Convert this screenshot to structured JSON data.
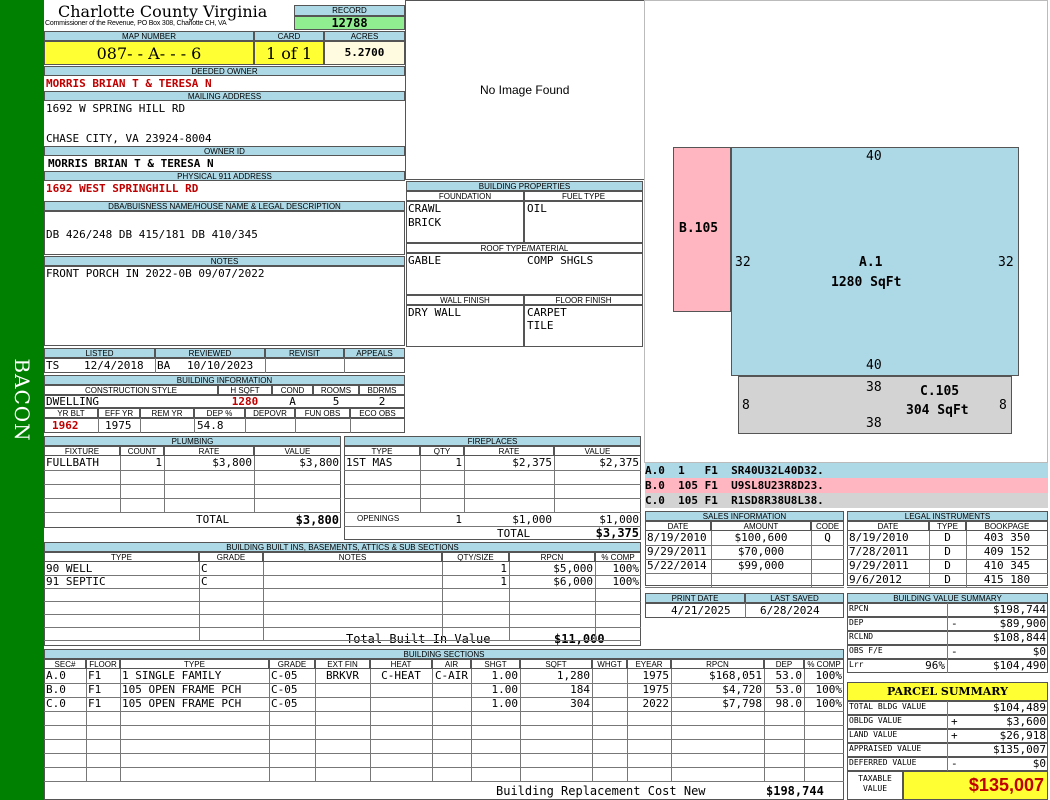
{
  "sidebar": {
    "label": "BACON",
    "color": "#008000"
  },
  "header": {
    "county": "Charlotte County Virginia",
    "commissioner": "Commissioner of the Revenue, PO Box 308, Charlotte CH, VA",
    "record_label": "RECORD",
    "record": "12788",
    "map_label": "MAP NUMBER",
    "map": "087- - A- - - 6",
    "card_label": "CARD",
    "card": "1 of 1",
    "acres_label": "ACRES",
    "acres": "5.2700"
  },
  "owner": {
    "deeded_label": "DEEDED OWNER",
    "deeded": "MORRIS BRIAN T & TERESA N",
    "mailing_label": "MAILING ADDRESS",
    "mail1": "1692 W SPRING HILL RD",
    "mail2": "CHASE CITY, VA 23924-8004",
    "ownerid_label": "OWNER ID",
    "ownerid": "MORRIS BRIAN T & TERESA N",
    "phys_label": "PHYSICAL 911 ADDRESS",
    "phys": "1692 WEST SPRINGHILL RD",
    "dba_label": "DBA/BUISNESS NAME/HOUSE NAME & LEGAL DESCRIPTION",
    "dba": "DB 426/248 DB 415/181 DB 410/345",
    "notes_label": "NOTES",
    "notes": "FRONT PORCH IN 2022-0B 09/07/2022"
  },
  "image": {
    "text": "No Image Found"
  },
  "bldgprops": {
    "title": "BUILDING PROPERTIES",
    "foundation_label": "FOUNDATION",
    "foundation1": "CRAWL",
    "foundation2": "BRICK",
    "fuel_label": "FUEL TYPE",
    "fuel": "OIL",
    "roof_label": "ROOF TYPE/MATERIAL",
    "roof1": "GABLE",
    "roof2": "COMP SHGLS",
    "wall_label": "WALL FINISH",
    "wall": "DRY WALL",
    "floor_label": "FLOOR FINISH",
    "floor1": "CARPET",
    "floor2": "TILE"
  },
  "review": {
    "listed_label": "LISTED",
    "reviewed_label": "REVIEWED",
    "revisit_label": "REVISIT",
    "appeals_label": "APPEALS",
    "listed_by": "TS",
    "listed": "12/4/2018",
    "reviewed_by": "BA",
    "reviewed": "10/10/2023"
  },
  "bldginfo": {
    "title": "BUILDING INFORMATION",
    "style_label": "CONSTRUCTION STYLE",
    "hsqft_label": "H SQFT",
    "cond_label": "COND",
    "rooms_label": "ROOMS",
    "bdrms_label": "BDRMS",
    "style": "DWELLING",
    "hsqft": "1280",
    "cond": "A",
    "rooms": "5",
    "bdrms": "2",
    "yrblt_label": "YR BLT",
    "effyr_label": "EFF YR",
    "remyr_label": "REM YR",
    "dep_label": "DEP %",
    "depovr_label": "DEPOVR",
    "funobs_label": "FUN OBS",
    "ecoobs_label": "ECO OBS",
    "yrblt": "1962",
    "effyr": "1975",
    "dep": "54.8"
  },
  "plumbing": {
    "title": "PLUMBING",
    "headers": [
      "FIXTURE",
      "COUNT",
      "RATE",
      "VALUE"
    ],
    "rows": [
      [
        "FULLBATH",
        "1",
        "$3,800",
        "$3,800"
      ]
    ],
    "total_label": "TOTAL",
    "total": "$3,800"
  },
  "fireplaces": {
    "title": "FIREPLACES",
    "headers": [
      "TYPE",
      "QTY",
      "RATE",
      "VALUE"
    ],
    "rows": [
      [
        "1ST MAS",
        "1",
        "$2,375",
        "$2,375"
      ]
    ],
    "openings_label": "OPENINGS",
    "openings": [
      "1",
      "$1,000",
      "$1,000"
    ],
    "total_label": "TOTAL",
    "total": "$3,375"
  },
  "builtins": {
    "title": "BUILDING BUILT INS, BASEMENTS, ATTICS & SUB SECTIONS",
    "headers": [
      "TYPE",
      "GRADE",
      "NOTES",
      "QTY/SIZE",
      "RPCN",
      "% COMP"
    ],
    "rows": [
      [
        "90 WELL",
        "C",
        "",
        "1",
        "$5,000",
        "100%"
      ],
      [
        "91 SEPTIC",
        "C",
        "",
        "1",
        "$6,000",
        "100%"
      ]
    ],
    "total_label": "Total Built In Value",
    "total": "$11,000"
  },
  "sections": {
    "title": "BUILDING SECTIONS",
    "headers": [
      "SEC#",
      "FLOOR",
      "TYPE",
      "GRADE",
      "EXT FIN",
      "HEAT",
      "AIR",
      "SHGT",
      "SQFT",
      "WHGT",
      "EYEAR",
      "RPCN",
      "DEP",
      "% COMP"
    ],
    "rows": [
      [
        "A.0",
        "F1",
        "1 SINGLE FAMILY",
        "C-05",
        "BRKVR",
        "C-HEAT",
        "C-AIR",
        "1.00",
        "1,280",
        "",
        "1975",
        "$168,051",
        "53.0",
        "100%"
      ],
      [
        "B.0",
        "F1",
        "105 OPEN FRAME PCH",
        "C-05",
        "",
        "",
        "",
        "1.00",
        "184",
        "",
        "1975",
        "$4,720",
        "53.0",
        "100%"
      ],
      [
        "C.0",
        "F1",
        "105 OPEN FRAME PCH",
        "C-05",
        "",
        "",
        "",
        "1.00",
        "304",
        "",
        "2022",
        "$7,798",
        "98.0",
        "100%"
      ]
    ],
    "rcn_label": "Building Replacement Cost New",
    "rcn": "$198,744"
  },
  "sketch": {
    "a": {
      "label": "A.1",
      "area": "1280 SqFt",
      "top": "40",
      "bottom": "40",
      "left": "32",
      "right": "32",
      "color": "#add8e6"
    },
    "b": {
      "label": "B.105",
      "color": "#ffb6c1"
    },
    "c": {
      "label": "C.105",
      "area": "304 SqFt",
      "top": "38",
      "bottom": "38",
      "left": "8",
      "right": "8",
      "color": "#d3d3d3"
    },
    "codes": [
      "A.0  1   F1  SR40U32L40D32.",
      "B.0  105 F1  U9SL8U23R8D23.",
      "C.0  105 F1  R1SD8R38U8L38."
    ]
  },
  "sales": {
    "title": "SALES INFORMATION",
    "headers": [
      "DATE",
      "AMOUNT",
      "CODE"
    ],
    "rows": [
      [
        "8/19/2010",
        "$100,600",
        "Q"
      ],
      [
        "9/29/2011",
        "$70,000",
        ""
      ],
      [
        "5/22/2014",
        "$99,000",
        ""
      ]
    ]
  },
  "legal": {
    "title": "LEGAL INSTRUMENTS",
    "headers": [
      "DATE",
      "TYPE",
      "BOOKPAGE"
    ],
    "rows": [
      [
        "8/19/2010",
        "D",
        "403 350"
      ],
      [
        "7/28/2011",
        "D",
        "409 152"
      ],
      [
        "9/29/2011",
        "D",
        "410 345"
      ],
      [
        "9/6/2012",
        "D",
        "415 180"
      ]
    ]
  },
  "dates": {
    "print_label": "PRINT DATE",
    "print": "4/21/2025",
    "saved_label": "LAST SAVED",
    "saved": "6/28/2024"
  },
  "bvs": {
    "title": "BUILDING VALUE SUMMARY",
    "rows": [
      [
        "RPCN",
        "",
        "$198,744"
      ],
      [
        "DEP",
        "-",
        "$89,900"
      ],
      [
        "RCLND",
        "",
        "$108,844"
      ],
      [
        "OBS F/E",
        "-",
        "$0"
      ],
      [
        "Lrr",
        "96%",
        "$104,490"
      ]
    ]
  },
  "parcel": {
    "title": "PARCEL SUMMARY",
    "rows": [
      [
        "TOTAL BLDG VALUE",
        "",
        "$104,489"
      ],
      [
        "OBLDG VALUE",
        "+",
        "$3,600"
      ],
      [
        "LAND VALUE",
        "+",
        "$26,918"
      ],
      [
        "APPRAISED VALUE",
        "",
        "$135,007"
      ],
      [
        "DEFERRED VALUE",
        "-",
        "$0"
      ]
    ],
    "taxable_label1": "TAXABLE",
    "taxable_label2": "VALUE",
    "taxable": "$135,007"
  }
}
